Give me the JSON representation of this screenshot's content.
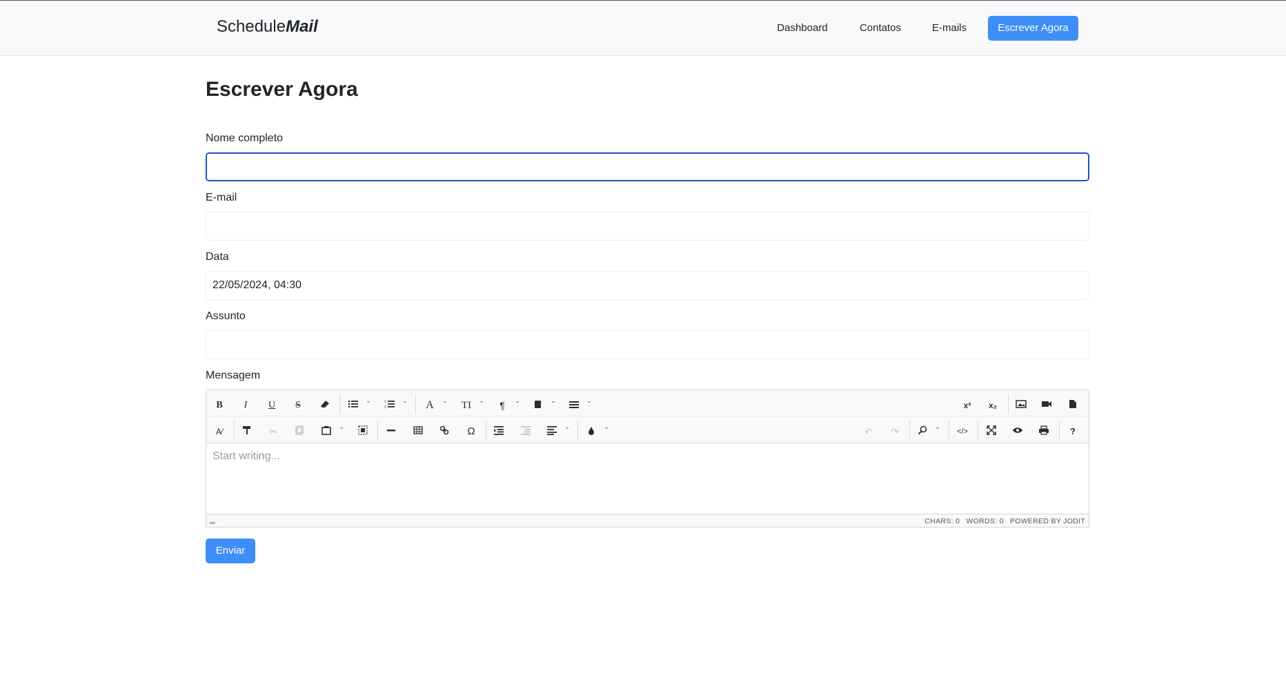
{
  "brand": {
    "prefix": "Schedule",
    "suffix": "Mail"
  },
  "nav": {
    "dashboard": "Dashboard",
    "contatos": "Contatos",
    "emails": "E-mails",
    "escrever": "Escrever Agora"
  },
  "page": {
    "title": "Escrever Agora"
  },
  "form": {
    "nome_label": "Nome completo",
    "nome_value": "",
    "email_label": "E-mail",
    "email_value": "",
    "data_label": "Data",
    "data_value": "22/05/2024, 04:30",
    "assunto_label": "Assunto",
    "assunto_value": "",
    "mensagem_label": "Mensagem"
  },
  "editor": {
    "placeholder": "Start writing...",
    "chars": "CHARS: 0",
    "words": "WORDS: 0",
    "powered": "POWERED BY JODIT",
    "toolbar_row1": [
      "bold-icon",
      "italic-icon",
      "underline-icon",
      "strikethrough-icon",
      "eraser-icon",
      "unordered-list-icon",
      "ordered-list-icon",
      "font-icon",
      "font-size-icon",
      "paragraph-icon",
      "classes-icon",
      "line-height-icon",
      "superscript-icon",
      "subscript-icon",
      "image-icon",
      "video-icon",
      "file-icon"
    ],
    "toolbar_row2": [
      "spellcheck-icon",
      "copy-format-icon",
      "cut-icon",
      "copy-icon",
      "paste-icon",
      "select-all-icon",
      "horizontal-rule-icon",
      "table-icon",
      "link-icon",
      "symbol-icon",
      "indent-icon",
      "outdent-icon",
      "align-icon",
      "brush-icon",
      "undo-icon",
      "redo-icon",
      "find-icon",
      "source-icon",
      "fullscreen-icon",
      "preview-icon",
      "print-icon",
      "help-icon"
    ]
  },
  "actions": {
    "send": "Enviar"
  },
  "colors": {
    "primary": "#3d8ef7",
    "focus_border": "#1a56c4",
    "navbar_bg": "#f8f9fa"
  }
}
